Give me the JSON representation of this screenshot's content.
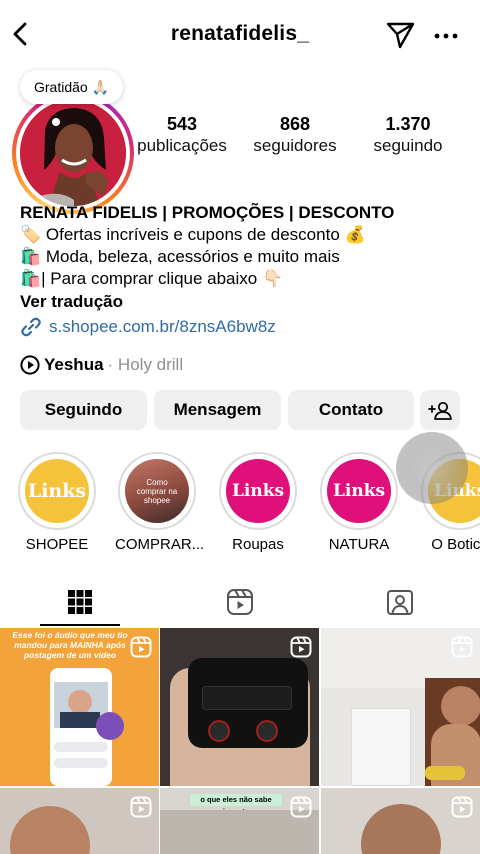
{
  "header": {
    "username": "renatafidelis_"
  },
  "note": "Gratidão 🙏🏻",
  "stats": [
    {
      "value": "543",
      "label": "publicações"
    },
    {
      "value": "868",
      "label": "seguidores"
    },
    {
      "value": "1.370",
      "label": "seguindo"
    }
  ],
  "bio": {
    "name": "RENATA FIDELIS | PROMOÇÕES | DESCONTO",
    "lines": [
      "🏷️ Ofertas incríveis e cupons de desconto 💰",
      "🛍️ Moda, beleza, acessórios e muito mais",
      "🛍️| Para comprar clique abaixo 👇🏻"
    ],
    "translate": "Ver tradução",
    "link": "s.shopee.com.br/8znsA6bw8z"
  },
  "music": {
    "track": "Yeshua",
    "artist": "· Holy drill"
  },
  "buttons": {
    "following": "Seguindo",
    "message": "Mensagem",
    "contact": "Contato"
  },
  "highlights": [
    {
      "label": "SHOPEE",
      "text": "Links",
      "color": "#f5c33b"
    },
    {
      "label": "COMPRAR...",
      "text": "Como comprar na shopee",
      "color": "#9b5a4a"
    },
    {
      "label": "Roupas",
      "text": "Links",
      "color": "#e0107a"
    },
    {
      "label": "NATURA",
      "text": "Links",
      "color": "#e0107a"
    },
    {
      "label": "O Botica",
      "text": "Links",
      "color": "#f5c33b"
    }
  ],
  "grid": {
    "post1_caption": "Esse foi o áudio que meu tio mandou para MAINHA após postagem de um vídeo",
    "post5_caption": "o que eles não sabe inventa"
  },
  "colors": {
    "link": "#2f6ca8",
    "button_bg": "#efefef",
    "secondary_text": "#8e8e8e"
  }
}
